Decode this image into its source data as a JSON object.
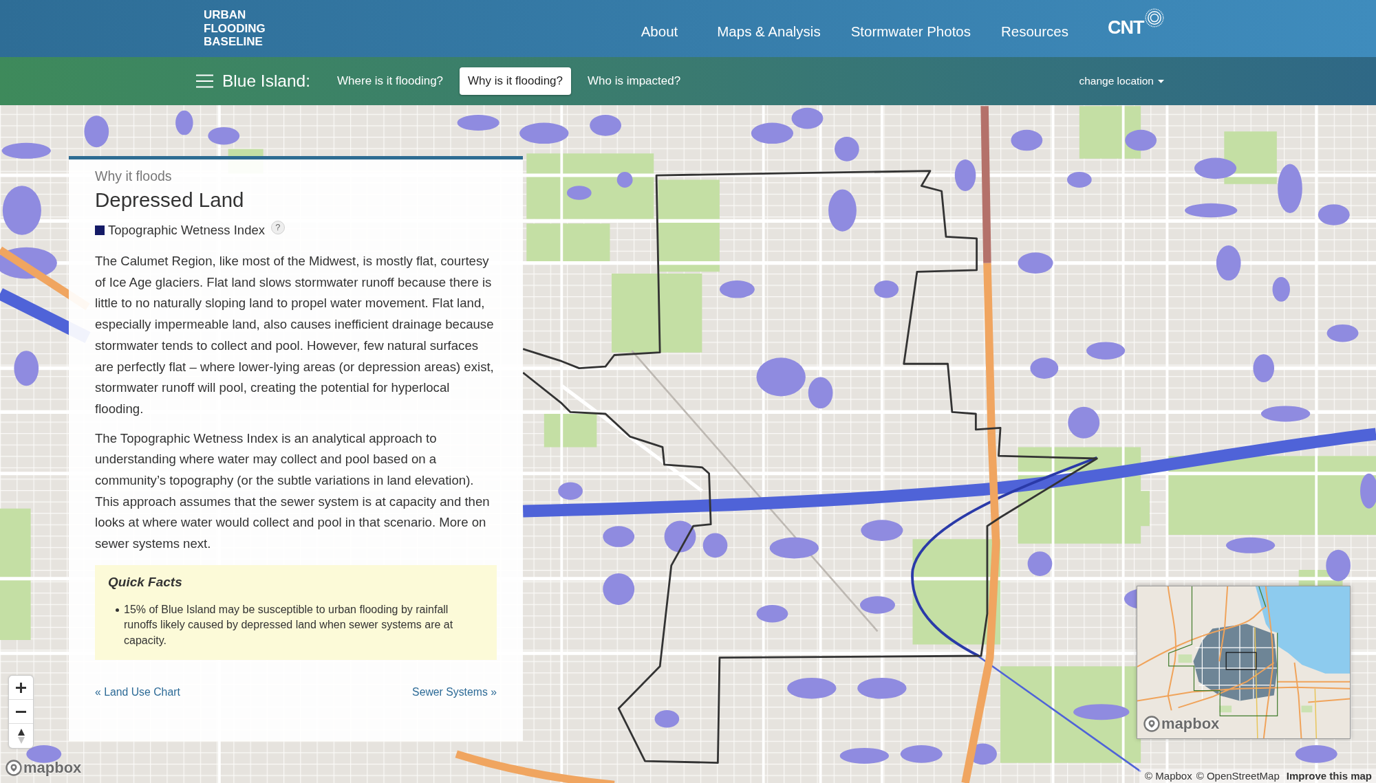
{
  "header": {
    "logo_lines": [
      "URBAN",
      "FLOODING",
      "BASELINE"
    ],
    "nav": [
      "About",
      "Maps & Analysis",
      "Stormwater Photos",
      "Resources"
    ],
    "partner_logo": "CNT"
  },
  "subnav": {
    "place": "Blue Island:",
    "tabs": [
      {
        "label": "Where is it flooding?",
        "selected": false
      },
      {
        "label": "Why is it flooding?",
        "selected": true
      },
      {
        "label": "Who is impacted?",
        "selected": false
      }
    ],
    "change_location": "change location"
  },
  "panel": {
    "eyebrow": "Why it floods",
    "title": "Depressed Land",
    "legend": [
      {
        "label": "Topographic Wetness Index",
        "color": "#141a66",
        "help": "?"
      }
    ],
    "paragraphs": [
      "The Calumet Region, like most of the Midwest, is mostly flat, courtesy of Ice Age glaciers. Flat land slows stormwater runoff because there is little to no naturally sloping land to propel water movement. Flat land, especially impermeable land, also causes inefficient drainage because stormwater tends to collect and pool. However, few natural surfaces are perfectly flat – where lower-lying areas (or depression areas) exist, stormwater runoff will pool, creating the potential for hyperlocal flooding.",
      "The Topographic Wetness Index is an analytical approach to understanding where water may collect and pool based on a community’s topography (or the subtle variations in land elevation). This approach assumes that the sewer system is at capacity and then looks at where water would collect and pool in that scenario. More on sewer systems next."
    ],
    "quick_facts": {
      "title": "Quick Facts",
      "items": [
        "15% of Blue Island may be susceptible to urban flooding by rainfall runoffs likely caused by depressed land when sewer systems are at capacity."
      ]
    },
    "prev_link": "« Land Use Chart",
    "next_link": "Sewer Systems »"
  },
  "map": {
    "logo": "mapbox",
    "minimap": {
      "logo": "mapbox"
    },
    "attribution": {
      "links": [
        "© Mapbox",
        "© OpenStreetMap"
      ],
      "improve": "Improve this map"
    }
  }
}
